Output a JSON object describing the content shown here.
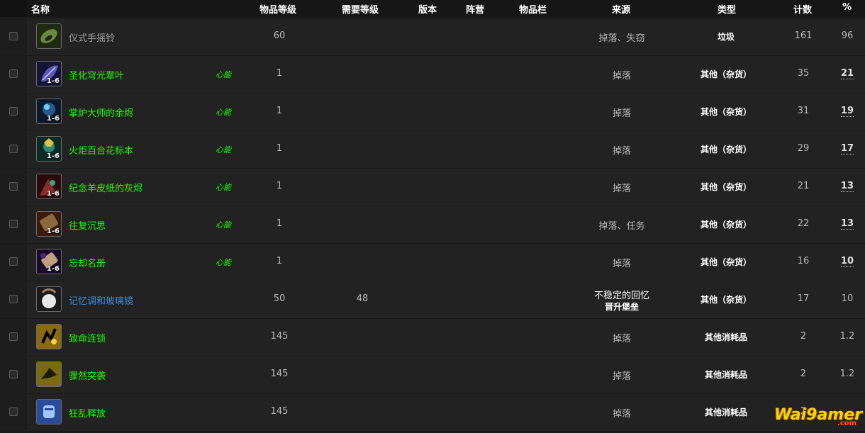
{
  "header": {
    "name": "名称",
    "item_level": "物品等级",
    "req_level": "需要等级",
    "version": "版本",
    "faction": "阵营",
    "slot": "物品栏",
    "source": "来源",
    "type": "类型",
    "count": "计数",
    "pct": "%"
  },
  "rows": [
    {
      "name": "仪式手摇铃",
      "quality": "gray",
      "tag": "",
      "stack": "",
      "item_level": "60",
      "req_level": "",
      "source": "掉落、失窃",
      "source2": "",
      "type": "垃圾",
      "count": "161",
      "pct": "96",
      "pct_link": false,
      "icon": "bell-icon",
      "icon_color": "#6a8a3a"
    },
    {
      "name": "圣化穹光翠叶",
      "quality": "green",
      "tag": "心能",
      "stack": "1-6",
      "item_level": "1",
      "req_level": "",
      "source": "掉落",
      "source2": "",
      "type": "其他（杂货）",
      "count": "35",
      "pct": "21",
      "pct_link": true,
      "icon": "leaf-icon",
      "icon_color": "#5a5ab8"
    },
    {
      "name": "掌炉大师的余烬",
      "quality": "green",
      "tag": "心能",
      "stack": "1-6",
      "item_level": "1",
      "req_level": "",
      "source": "掉落",
      "source2": "",
      "type": "其他（杂货）",
      "count": "31",
      "pct": "19",
      "pct_link": true,
      "icon": "ember-icon",
      "icon_color": "#2a5a8a"
    },
    {
      "name": "火炬百合花标本",
      "quality": "green",
      "tag": "心能",
      "stack": "1-6",
      "item_level": "1",
      "req_level": "",
      "source": "掉落",
      "source2": "",
      "type": "其他（杂货）",
      "count": "29",
      "pct": "17",
      "pct_link": true,
      "icon": "lily-icon",
      "icon_color": "#2a8a7a"
    },
    {
      "name": "纪念羊皮纸的灰烬",
      "quality": "green",
      "tag": "心能",
      "stack": "1-6",
      "item_level": "1",
      "req_level": "",
      "source": "掉落",
      "source2": "",
      "type": "其他（杂货）",
      "count": "21",
      "pct": "13",
      "pct_link": true,
      "icon": "ash-icon",
      "icon_color": "#8a2a2a"
    },
    {
      "name": "往复沉思",
      "quality": "green",
      "tag": "心能",
      "stack": "1-6",
      "item_level": "1",
      "req_level": "",
      "source": "掉落、任务",
      "source2": "",
      "type": "其他（杂货）",
      "count": "22",
      "pct": "13",
      "pct_link": true,
      "icon": "scroll-icon",
      "icon_color": "#8a6a3a"
    },
    {
      "name": "忘却名册",
      "quality": "green",
      "tag": "心能",
      "stack": "1-6",
      "item_level": "1",
      "req_level": "",
      "source": "掉落",
      "source2": "",
      "type": "其他（杂货）",
      "count": "16",
      "pct": "10",
      "pct_link": true,
      "icon": "scroll-purple-icon",
      "icon_color": "#4a2a7a"
    },
    {
      "name": "记忆调和玻璃镜",
      "quality": "blue",
      "tag": "",
      "stack": "",
      "item_level": "50",
      "req_level": "48",
      "source": "不稳定的回忆",
      "source2": "晋升堡垒",
      "type": "其他（杂货）",
      "count": "17",
      "pct": "10",
      "pct_link": false,
      "icon": "orb-icon",
      "icon_color": "#6a6a6a"
    },
    {
      "name": "致命连锁",
      "quality": "green",
      "tag": "",
      "stack": "",
      "item_level": "145",
      "req_level": "",
      "source": "掉落",
      "source2": "",
      "type": "其他消耗品",
      "count": "2",
      "pct": "1.2",
      "pct_link": false,
      "icon": "chain-icon",
      "icon_color": "#8a6a10"
    },
    {
      "name": "骤然突袭",
      "quality": "green",
      "tag": "",
      "stack": "",
      "item_level": "145",
      "req_level": "",
      "source": "掉落",
      "source2": "",
      "type": "其他消耗品",
      "count": "2",
      "pct": "1.2",
      "pct_link": false,
      "icon": "strike-icon",
      "icon_color": "#7a6a10"
    },
    {
      "name": "狂乱释放",
      "quality": "green",
      "tag": "",
      "stack": "",
      "item_level": "145",
      "req_level": "",
      "source": "掉落",
      "source2": "",
      "type": "其他消耗品",
      "count": "2",
      "pct": "",
      "pct_link": false,
      "icon": "fist-icon",
      "icon_color": "#2a4a9a"
    }
  ],
  "watermark": {
    "text": "Wai9amer",
    "sub": ".com"
  },
  "colors": {
    "green": "#1eff00",
    "gray": "#9d9d9d",
    "blue": "#3a8fd8"
  }
}
